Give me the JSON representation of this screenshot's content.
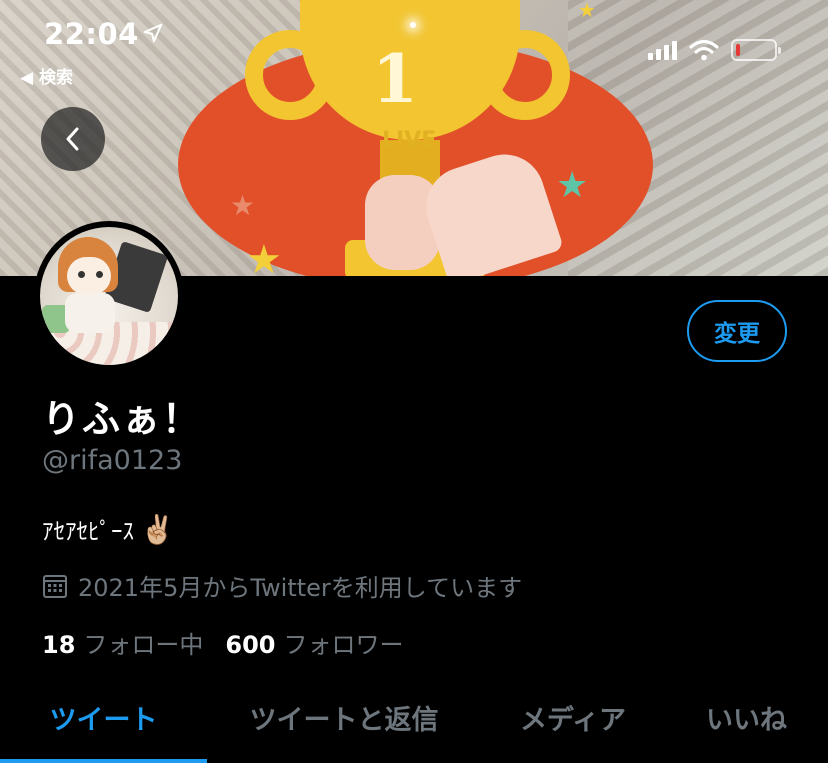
{
  "status_bar": {
    "time": "22:04",
    "back_app_label": "◀ 検索"
  },
  "banner": {
    "trophy_number": "1",
    "trophy_text": "LIVE"
  },
  "profile": {
    "display_name": "りふぁ！",
    "handle": "@rifa0123",
    "bio_text": "ｱｾｱｾﾋﾟｰｽ",
    "bio_emoji": "✌🏼",
    "joined_text": "2021年5月からTwitterを利用しています",
    "following_count": "18",
    "following_label": "フォロー中",
    "followers_count": "600",
    "followers_label": "フォロワー"
  },
  "edit_button_label": "変更",
  "tabs": [
    {
      "label": "ツイート",
      "active": true
    },
    {
      "label": "ツイートと返信",
      "active": false
    },
    {
      "label": "メディア",
      "active": false
    },
    {
      "label": "いいね",
      "active": false
    }
  ],
  "colors": {
    "accent": "#1d9bf0",
    "muted_text": "#6e767d",
    "background": "#000000"
  },
  "icons": {
    "back": "chevron-left-icon",
    "calendar": "calendar-icon",
    "location": "location-arrow-icon",
    "signal": "cellular-signal-icon",
    "wifi": "wifi-icon",
    "battery": "battery-icon"
  }
}
